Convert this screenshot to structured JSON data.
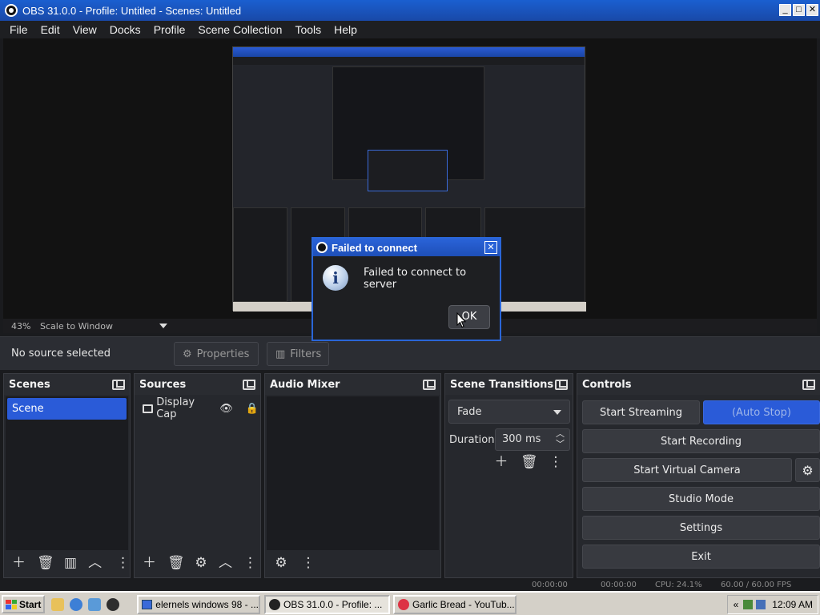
{
  "window": {
    "title": "OBS 31.0.0 - Profile: Untitled - Scenes: Untitled",
    "min": "_",
    "max": "□",
    "close": "✕"
  },
  "menu": [
    "File",
    "Edit",
    "View",
    "Docks",
    "Profile",
    "Scene Collection",
    "Tools",
    "Help"
  ],
  "preview": {
    "zoom": "43%",
    "scale_mode": "Scale to Window"
  },
  "sourcebar": {
    "no_source": "No source selected",
    "properties": "Properties",
    "filters": "Filters"
  },
  "docks": {
    "scenes": {
      "title": "Scenes",
      "items": [
        "Scene"
      ]
    },
    "sources": {
      "title": "Sources",
      "items": [
        "Display Cap"
      ]
    },
    "mixer": {
      "title": "Audio Mixer"
    },
    "transitions": {
      "title": "Scene Transitions",
      "selected": "Fade",
      "duration_label": "Duration",
      "duration_value": "300 ms"
    },
    "controls": {
      "title": "Controls",
      "start_streaming": "Start Streaming",
      "auto_stop": "(Auto Stop)",
      "start_recording": "Start Recording",
      "start_virtual_camera": "Start Virtual Camera",
      "studio_mode": "Studio Mode",
      "settings": "Settings",
      "exit": "Exit"
    }
  },
  "dialog": {
    "title": "Failed to connect",
    "message": "Failed to connect to server",
    "ok": "OK",
    "close": "✕"
  },
  "statusbar": {
    "time1": "00:00:00",
    "time2": "00:00:00",
    "cpu": "CPU: 24.1%",
    "fps": "60.00 / 60.00 FPS"
  },
  "taskbar": {
    "start": "Start",
    "tasks": [
      "elernels windows 98 - ...",
      "OBS 31.0.0 - Profile: ...",
      "Garlic Bread - YouTub..."
    ],
    "clock": "12:09 AM",
    "tray_chevron": "«"
  },
  "colors": {
    "accent": "#2a5bd8",
    "titlebar": "#1a5fd0",
    "panel": "#26282d"
  }
}
